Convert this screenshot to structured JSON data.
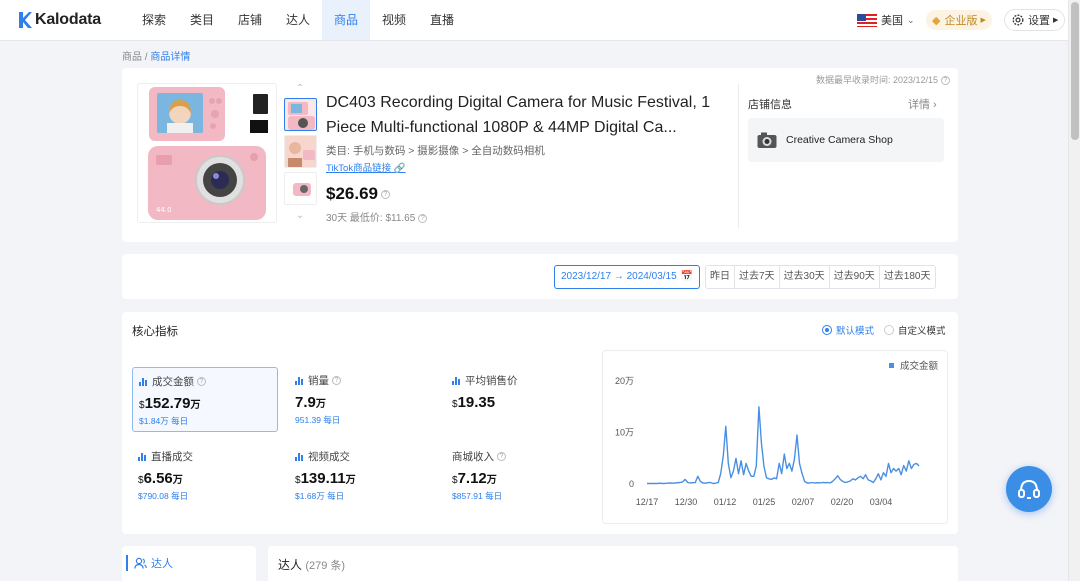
{
  "app": {
    "name": "Kalodata"
  },
  "nav": {
    "items": [
      "探索",
      "类目",
      "店铺",
      "达人",
      "商品",
      "视频",
      "直播"
    ],
    "active_index": 4
  },
  "header": {
    "region": "美国",
    "enterprise": "企业版",
    "settings": "设置"
  },
  "breadcrumb": {
    "parent": "商品",
    "sep": "/",
    "current": "商品详情"
  },
  "product": {
    "title": "DC403 Recording Digital Camera for Music Festival, 1 Piece Multi-functional 1080P & 44MP Digital Ca...",
    "category": "类目: 手机与数码 > 摄影摄像 > 全自动数码相机",
    "tiktok_link": "TikTok商品链接",
    "price": "$26.69",
    "low_price": "30天 最低价: $11.65",
    "updated": "数据最早收录时间: 2023/12/15"
  },
  "shop": {
    "label": "店铺信息",
    "detail": "详情",
    "name": "Creative Camera Shop"
  },
  "date": {
    "range": "2023/12/17 → 2024/03/15",
    "quick": [
      "昨日",
      "过去7天",
      "过去30天",
      "过去90天",
      "过去180天"
    ]
  },
  "metrics": {
    "title": "核心指标",
    "modes": [
      "默认模式",
      "自定义模式"
    ],
    "items": [
      {
        "label": "成交金额",
        "value": "152.79",
        "unit": "万",
        "prefix": "$",
        "sub": "$1.84万 每日"
      },
      {
        "label": "销量",
        "value": "7.9",
        "unit": "万",
        "prefix": "",
        "sub": "951.39 每日"
      },
      {
        "label": "平均销售价",
        "value": "19.35",
        "unit": "",
        "prefix": "$",
        "sub": ""
      },
      {
        "label": "直播成交",
        "value": "6.56",
        "unit": "万",
        "prefix": "$",
        "sub": "$790.08 每日"
      },
      {
        "label": "视频成交",
        "value": "139.11",
        "unit": "万",
        "prefix": "$",
        "sub": "$1.68万 每日"
      },
      {
        "label": "商城收入",
        "value": "7.12",
        "unit": "万",
        "prefix": "$",
        "sub": "$857.91 每日"
      }
    ]
  },
  "chart_data": {
    "type": "line",
    "legend": "成交金额",
    "legend_position": "top-right",
    "x_ticks": [
      "12/17",
      "12/30",
      "01/12",
      "01/25",
      "02/07",
      "02/20",
      "03/04"
    ],
    "y_ticks": [
      "0",
      "10万",
      "20万"
    ],
    "ylim": [
      0,
      200000
    ],
    "series": [
      {
        "name": "成交金额",
        "color": "#4a90e2",
        "values": [
          1000,
          1000,
          1000,
          1200,
          1000,
          1500,
          1000,
          1200,
          1500,
          2000,
          1500,
          2000,
          2500,
          3000,
          4000,
          9000,
          3000,
          2000,
          2500,
          3000,
          15000,
          5000,
          2000,
          1500,
          2500,
          3000,
          1000,
          1500,
          3000,
          20000,
          55000,
          112000,
          40000,
          12000,
          25000,
          50000,
          20000,
          45000,
          18000,
          40000,
          25000,
          15000,
          15000,
          35000,
          150000,
          80000,
          35000,
          12000,
          10000,
          9000,
          12000,
          10000,
          40000,
          20000,
          58000,
          30000,
          40000,
          25000,
          48000,
          95000,
          40000,
          20000,
          5000,
          2000,
          2000,
          3000,
          2000,
          2500,
          2000,
          3000,
          2500,
          3000,
          2000,
          5000,
          10000,
          16000,
          9000,
          5000,
          3000,
          4000,
          6000,
          10000,
          8000,
          12000,
          15000,
          10000,
          18000,
          8000,
          6000,
          3000,
          10000,
          20000,
          8000,
          22000,
          15000,
          40000,
          22000,
          30000,
          25000,
          30000,
          18000,
          36000,
          25000,
          45000,
          30000,
          38000,
          40000,
          35000
        ]
      }
    ]
  },
  "bottom": {
    "tab": "达人",
    "kol_title": "达人",
    "kol_count": "(279 条)"
  }
}
